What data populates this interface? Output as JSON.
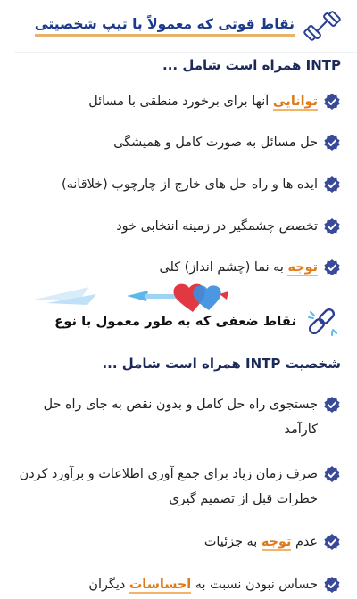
{
  "strengths": {
    "title": "نقاط قوتی که معمولاً با تیپ شخصیتی",
    "intro": "INTP همراه است شامل ...",
    "items": [
      {
        "highlight": "توانایی",
        "rest": " آنها برای برخورد منطقی با مسائل"
      },
      {
        "highlight": "",
        "rest": "حل مسائل به صورت کامل و همیشگی"
      },
      {
        "highlight": "",
        "rest": "ایده ها و راه حل های خارج از چارچوب (خلاقانه)"
      },
      {
        "highlight": "",
        "rest": "تخصص چشمگیر در زمینه انتخابی خود"
      },
      {
        "highlight": "توجه",
        "rest": " به نما (چشم انداز) کلی"
      }
    ]
  },
  "weaknesses": {
    "title": "نقاط ضعفی که به طور معمول با نوع",
    "intro": "شخصیت INTP همراه است شامل ...",
    "items": [
      {
        "text": "جستجوی راه حل کامل و بدون نقص به جای راه حل کارآمد"
      },
      {
        "text": "صرف زمان زیاد برای جمع آوری اطلاعات و برآورد کردن خطرات قبل از تصمیم گیری"
      },
      {
        "pre": "عدم ",
        "highlight": "توجه",
        "post": " به جزئیات"
      },
      {
        "pre": "حساس نبودن نسبت به ",
        "highlight": "احساسات",
        "post": " دیگران"
      }
    ]
  },
  "icons": {
    "strength": "dumbbell-icon",
    "weakness": "broken-chain-icon",
    "check": "check-badge-icon",
    "divider": "hearts-arrow-icon"
  },
  "colors": {
    "accent": "#e07a19",
    "navy": "#1c3a8c",
    "check": "#3a4a9a"
  }
}
